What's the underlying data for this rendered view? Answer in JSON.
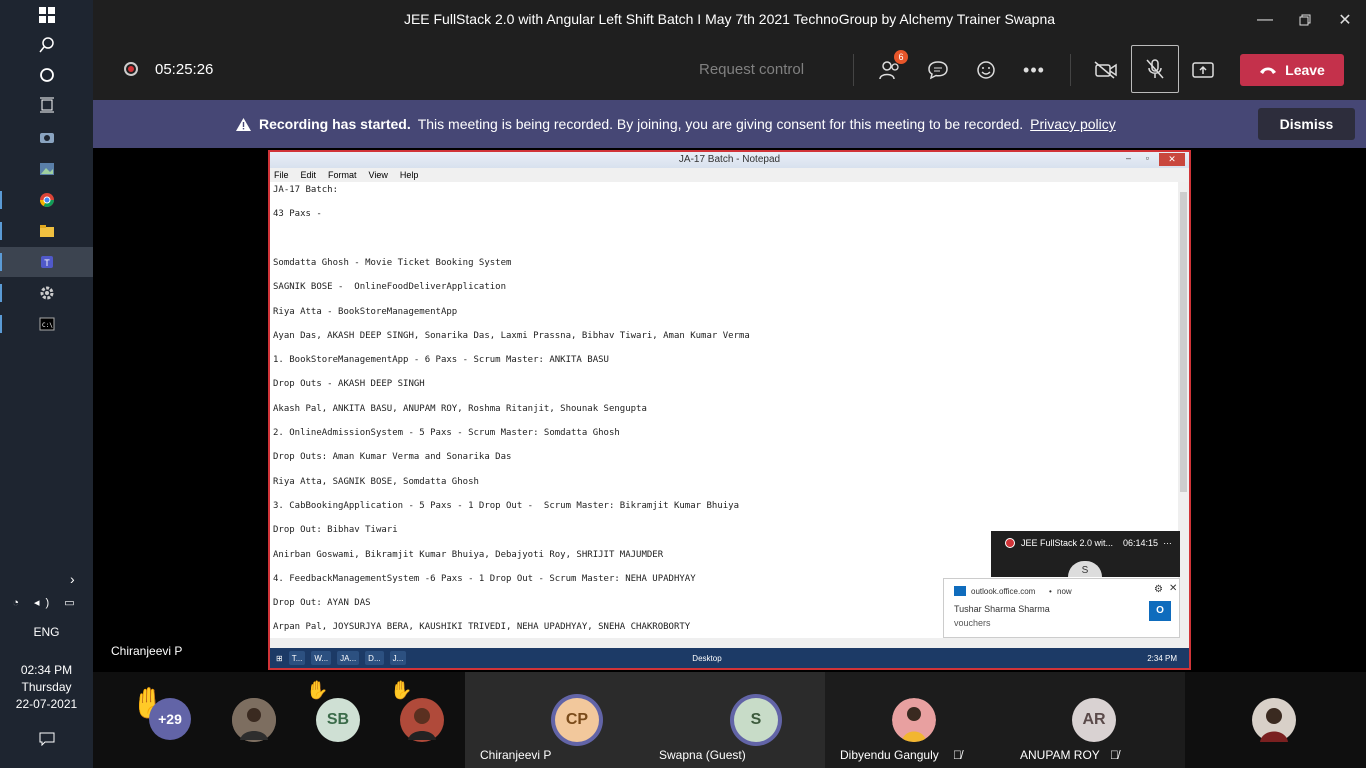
{
  "window": {
    "title": "JEE FullStack 2.0 with Angular Left Shift Batch I May 7th 2021 TechnoGroup by Alchemy Trainer Swapna"
  },
  "toolbar": {
    "timer": "05:25:26",
    "request_control": "Request control",
    "participants_count": "6",
    "leave_label": "Leave"
  },
  "banner": {
    "title": "Recording has started.",
    "message": "This meeting is being recorded. By joining, you are giving consent for this meeting to be recorded.",
    "link": "Privacy policy",
    "dismiss": "Dismiss"
  },
  "presenter": {
    "name": "Chiranjeevi P"
  },
  "notepad": {
    "title": "JA-17 Batch - Notepad",
    "menu": [
      "File",
      "Edit",
      "Format",
      "View",
      "Help"
    ],
    "lines": [
      "JA-17 Batch:",
      "",
      "43 Paxs -",
      "",
      "",
      "",
      "Somdatta Ghosh - Movie Ticket Booking System",
      "",
      "SAGNIK BOSE -  OnlineFoodDeliverApplication",
      "",
      "Riya Atta - BookStoreManagementApp",
      "",
      "Ayan Das, AKASH DEEP SINGH, Sonarika Das, Laxmi Prassna, Bibhav Tiwari, Aman Kumar Verma",
      "",
      "1. BookStoreManagementApp - 6 Paxs - Scrum Master: ANKITA BASU",
      "",
      "Drop Outs - AKASH DEEP SINGH",
      "",
      "Akash Pal, ANKITA BASU, ANUPAM ROY, Roshma Ritanjit, Shounak Sengupta",
      "",
      "2. OnlineAdmissionSystem - 5 Paxs - Scrum Master: Somdatta Ghosh",
      "",
      "Drop Outs: Aman Kumar Verma and Sonarika Das",
      "",
      "Riya Atta, SAGNIK BOSE, Somdatta Ghosh",
      "",
      "3. CabBookingApplication - 5 Paxs - 1 Drop Out -  Scrum Master: Bikramjit Kumar Bhuiya",
      "",
      "Drop Out: Bibhav Tiwari",
      "",
      "Anirban Goswami, Bikramjit Kumar Bhuiya, Debajyoti Roy, SHRIJIT MAJUMDER",
      "",
      "4. FeedbackManagementSystem -6 Paxs - 1 Drop Out - Scrum Master: NEHA UPADHYAY",
      "",
      "Drop Out: AYAN DAS",
      "",
      "Arpan Pal, JOYSURJYA BERA, KAUSHIKI TRIVEDI, NEHA UPADHYAY, SNEHA CHAKROBORTY"
    ],
    "taskbar_items": [
      "T...",
      "W...",
      "JA...",
      "D...",
      "J..."
    ],
    "taskbar_desktop": "Desktop",
    "taskbar_clock": "2:34 PM"
  },
  "mini_window": {
    "title": "JEE FullStack 2.0 wit...",
    "time": "06:14:15",
    "initial": "S"
  },
  "toast": {
    "source": "outlook.office.com",
    "when": "now",
    "sender": "Tushar Sharma Sharma",
    "subject": "vouchers"
  },
  "system": {
    "language": "ENG",
    "time": "02:34 PM",
    "day": "Thursday",
    "date": "22-07-2021"
  },
  "participants": {
    "overflow": "+29",
    "sb_initials": "SB",
    "tiles": [
      {
        "initials": "CP",
        "name": "Chiranjeevi P",
        "bg": "#f2c89c",
        "color": "#7a4b1a"
      },
      {
        "initials": "S",
        "name": "Swapna (Guest)",
        "bg": "#c8dcc8",
        "color": "#3c5a3c"
      },
      {
        "initials": "",
        "name": "Dibyendu Ganguly",
        "bg": "#e8a0a0",
        "color": "#5a2020"
      },
      {
        "initials": "AR",
        "name": "ANUPAM ROY",
        "bg": "#d9d2d2",
        "color": "#5a4a4a"
      }
    ]
  },
  "colors": {
    "accent": "#6264a7",
    "banner": "#464775",
    "leave": "#c4314b",
    "record": "#d13438"
  }
}
